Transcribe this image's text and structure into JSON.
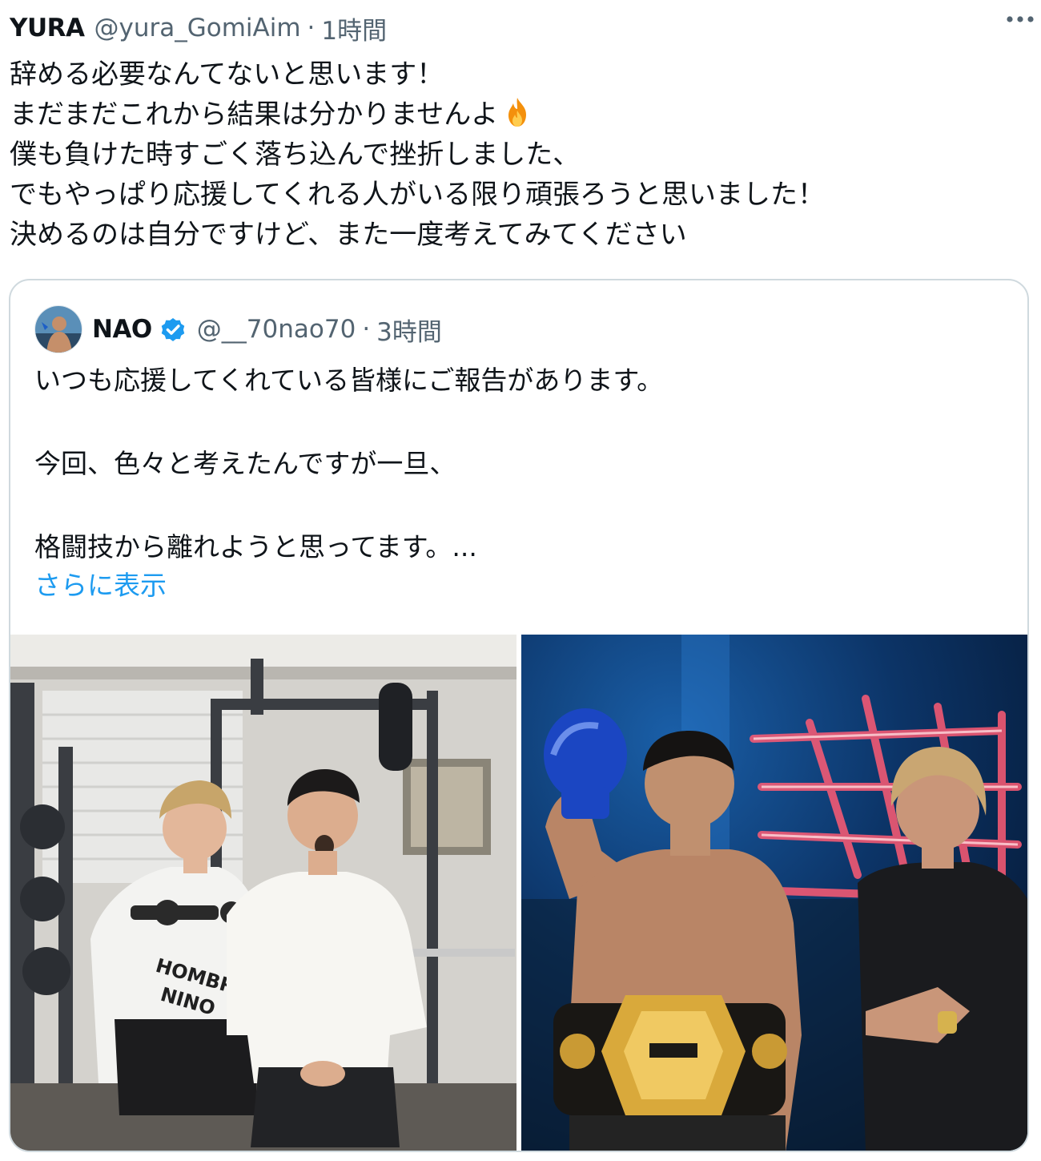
{
  "tweet": {
    "author_name": "YURA",
    "author_handle": "@yura_GomiAim",
    "separator": "·",
    "time": "1時間",
    "more_icon": "more-horizontal-icon",
    "lines": [
      "辞める必要なんてないと思います！",
      "まだまだこれから結果は分かりませんよ",
      "僕も負けた時すごく落ち込んで挫折しました、",
      "でもやっぱり応援してくれる人がいる限り頑張ろうと思いました！",
      "決めるのは自分ですけど、また一度考えてみてください"
    ],
    "emoji": "fire-icon"
  },
  "quote": {
    "author_name": "NAO",
    "verified_icon": "verified-badge-icon",
    "author_handle": "@__70nao70",
    "separator": "·",
    "time": "3時間",
    "lines": [
      "いつも応援してくれている皆様にご報告があります。",
      "今回、色々と考えたんですが一旦、",
      "格闘技から離れようと思ってます。..."
    ],
    "show_more": "さらに表示",
    "media": [
      {
        "desc": "gym-photo",
        "shirt_print": [
          "HOMBRE",
          "NINO"
        ]
      },
      {
        "desc": "championship-belt-photo"
      }
    ]
  },
  "colors": {
    "text": "#0f1419",
    "secondary": "#536471",
    "link": "#1d9bf0",
    "border": "#cfd9de",
    "verified": "#1d9bf0"
  }
}
